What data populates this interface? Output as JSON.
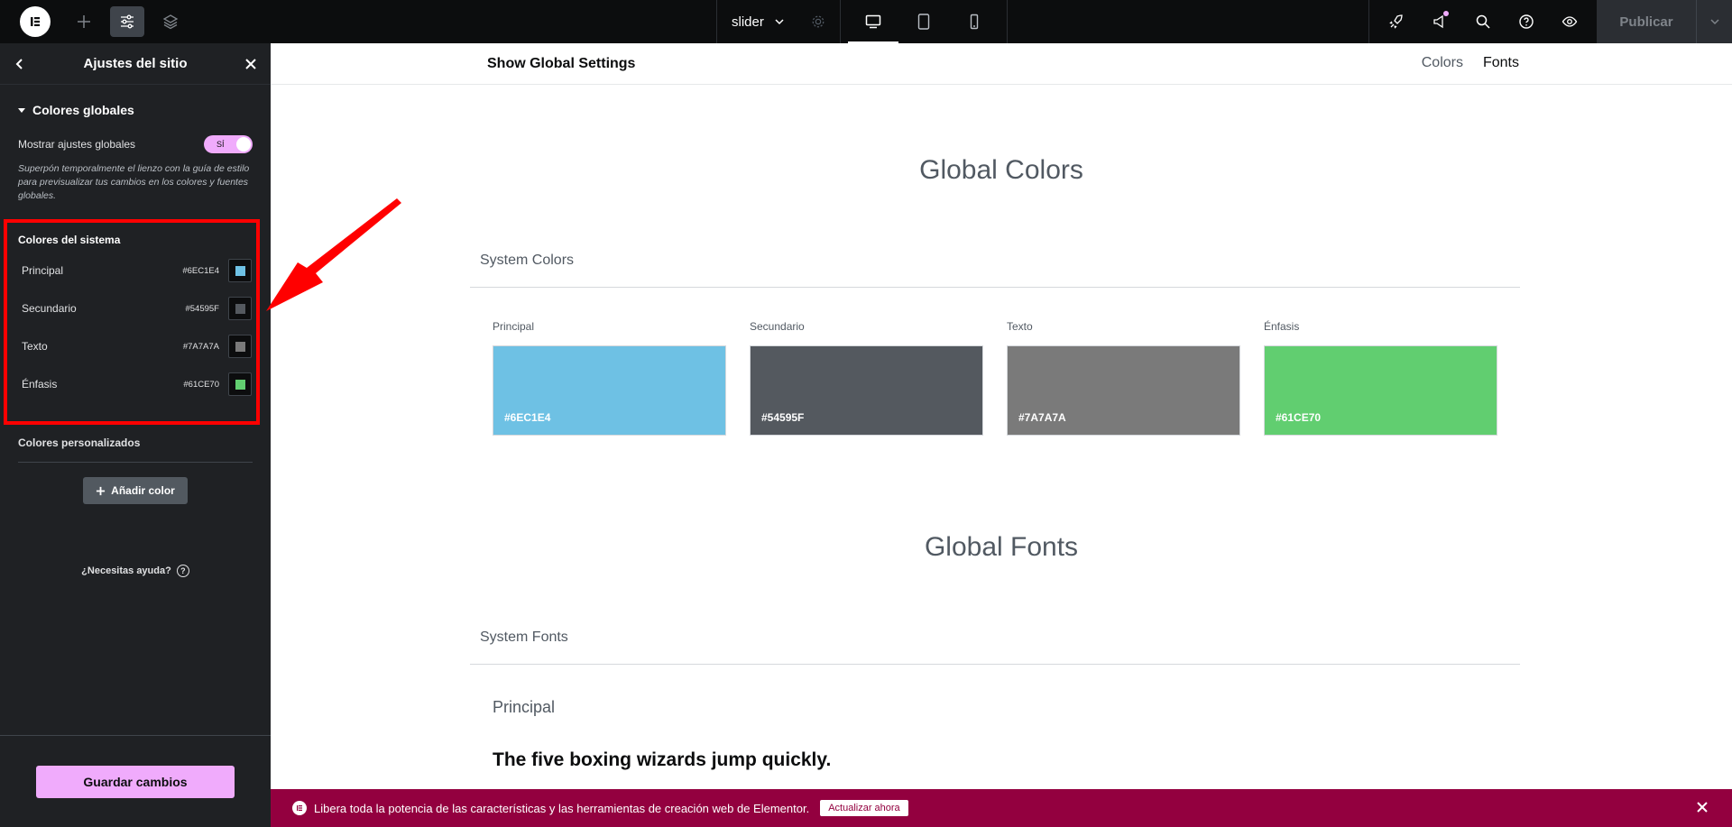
{
  "topbar": {
    "page_name": "slider",
    "publish_label": "Publicar"
  },
  "sidebar": {
    "title": "Ajustes del sitio",
    "section_title": "Colores globales",
    "toggle_label": "Mostrar ajustes globales",
    "toggle_value": "SÍ",
    "help_text": "Superpón temporalmente el lienzo con la guía de estilo para previsualizar tus cambios en los colores y fuentes globales.",
    "system_colors_title": "Colores del sistema",
    "system_colors": [
      {
        "name": "Principal",
        "hex": "#6EC1E4",
        "color": "#6ec1e4"
      },
      {
        "name": "Secundario",
        "hex": "#54595F",
        "color": "#54595f"
      },
      {
        "name": "Texto",
        "hex": "#7A7A7A",
        "color": "#7a7a7a"
      },
      {
        "name": "Énfasis",
        "hex": "#61CE70",
        "color": "#61ce70"
      }
    ],
    "custom_colors_title": "Colores personalizados",
    "add_color_label": "Añadir color",
    "need_help": "¿Necesitas ayuda?",
    "save_label": "Guardar cambios"
  },
  "canvas": {
    "bar_title": "Show Global Settings",
    "link_colors": "Colors",
    "link_fonts": "Fonts",
    "global_colors_heading": "Global Colors",
    "system_colors_heading": "System Colors",
    "cards": [
      {
        "label": "Principal",
        "hex": "#6EC1E4",
        "color": "#6ec1e4"
      },
      {
        "label": "Secundario",
        "hex": "#54595F",
        "color": "#54595f"
      },
      {
        "label": "Texto",
        "hex": "#7A7A7A",
        "color": "#7a7a7a"
      },
      {
        "label": "Énfasis",
        "hex": "#61CE70",
        "color": "#61ce70"
      }
    ],
    "global_fonts_heading": "Global Fonts",
    "system_fonts_heading": "System Fonts",
    "font_label": "Principal",
    "font_sample": "The five boxing wizards jump quickly."
  },
  "promo": {
    "message": "Libera toda la potencia de las características y las herramientas de creación web de Elementor.",
    "button_label": "Actualizar ahora"
  },
  "colors": {
    "accent": "#f0abfc",
    "promo_bg": "#93003f",
    "annotation_red": "#ff0000"
  }
}
